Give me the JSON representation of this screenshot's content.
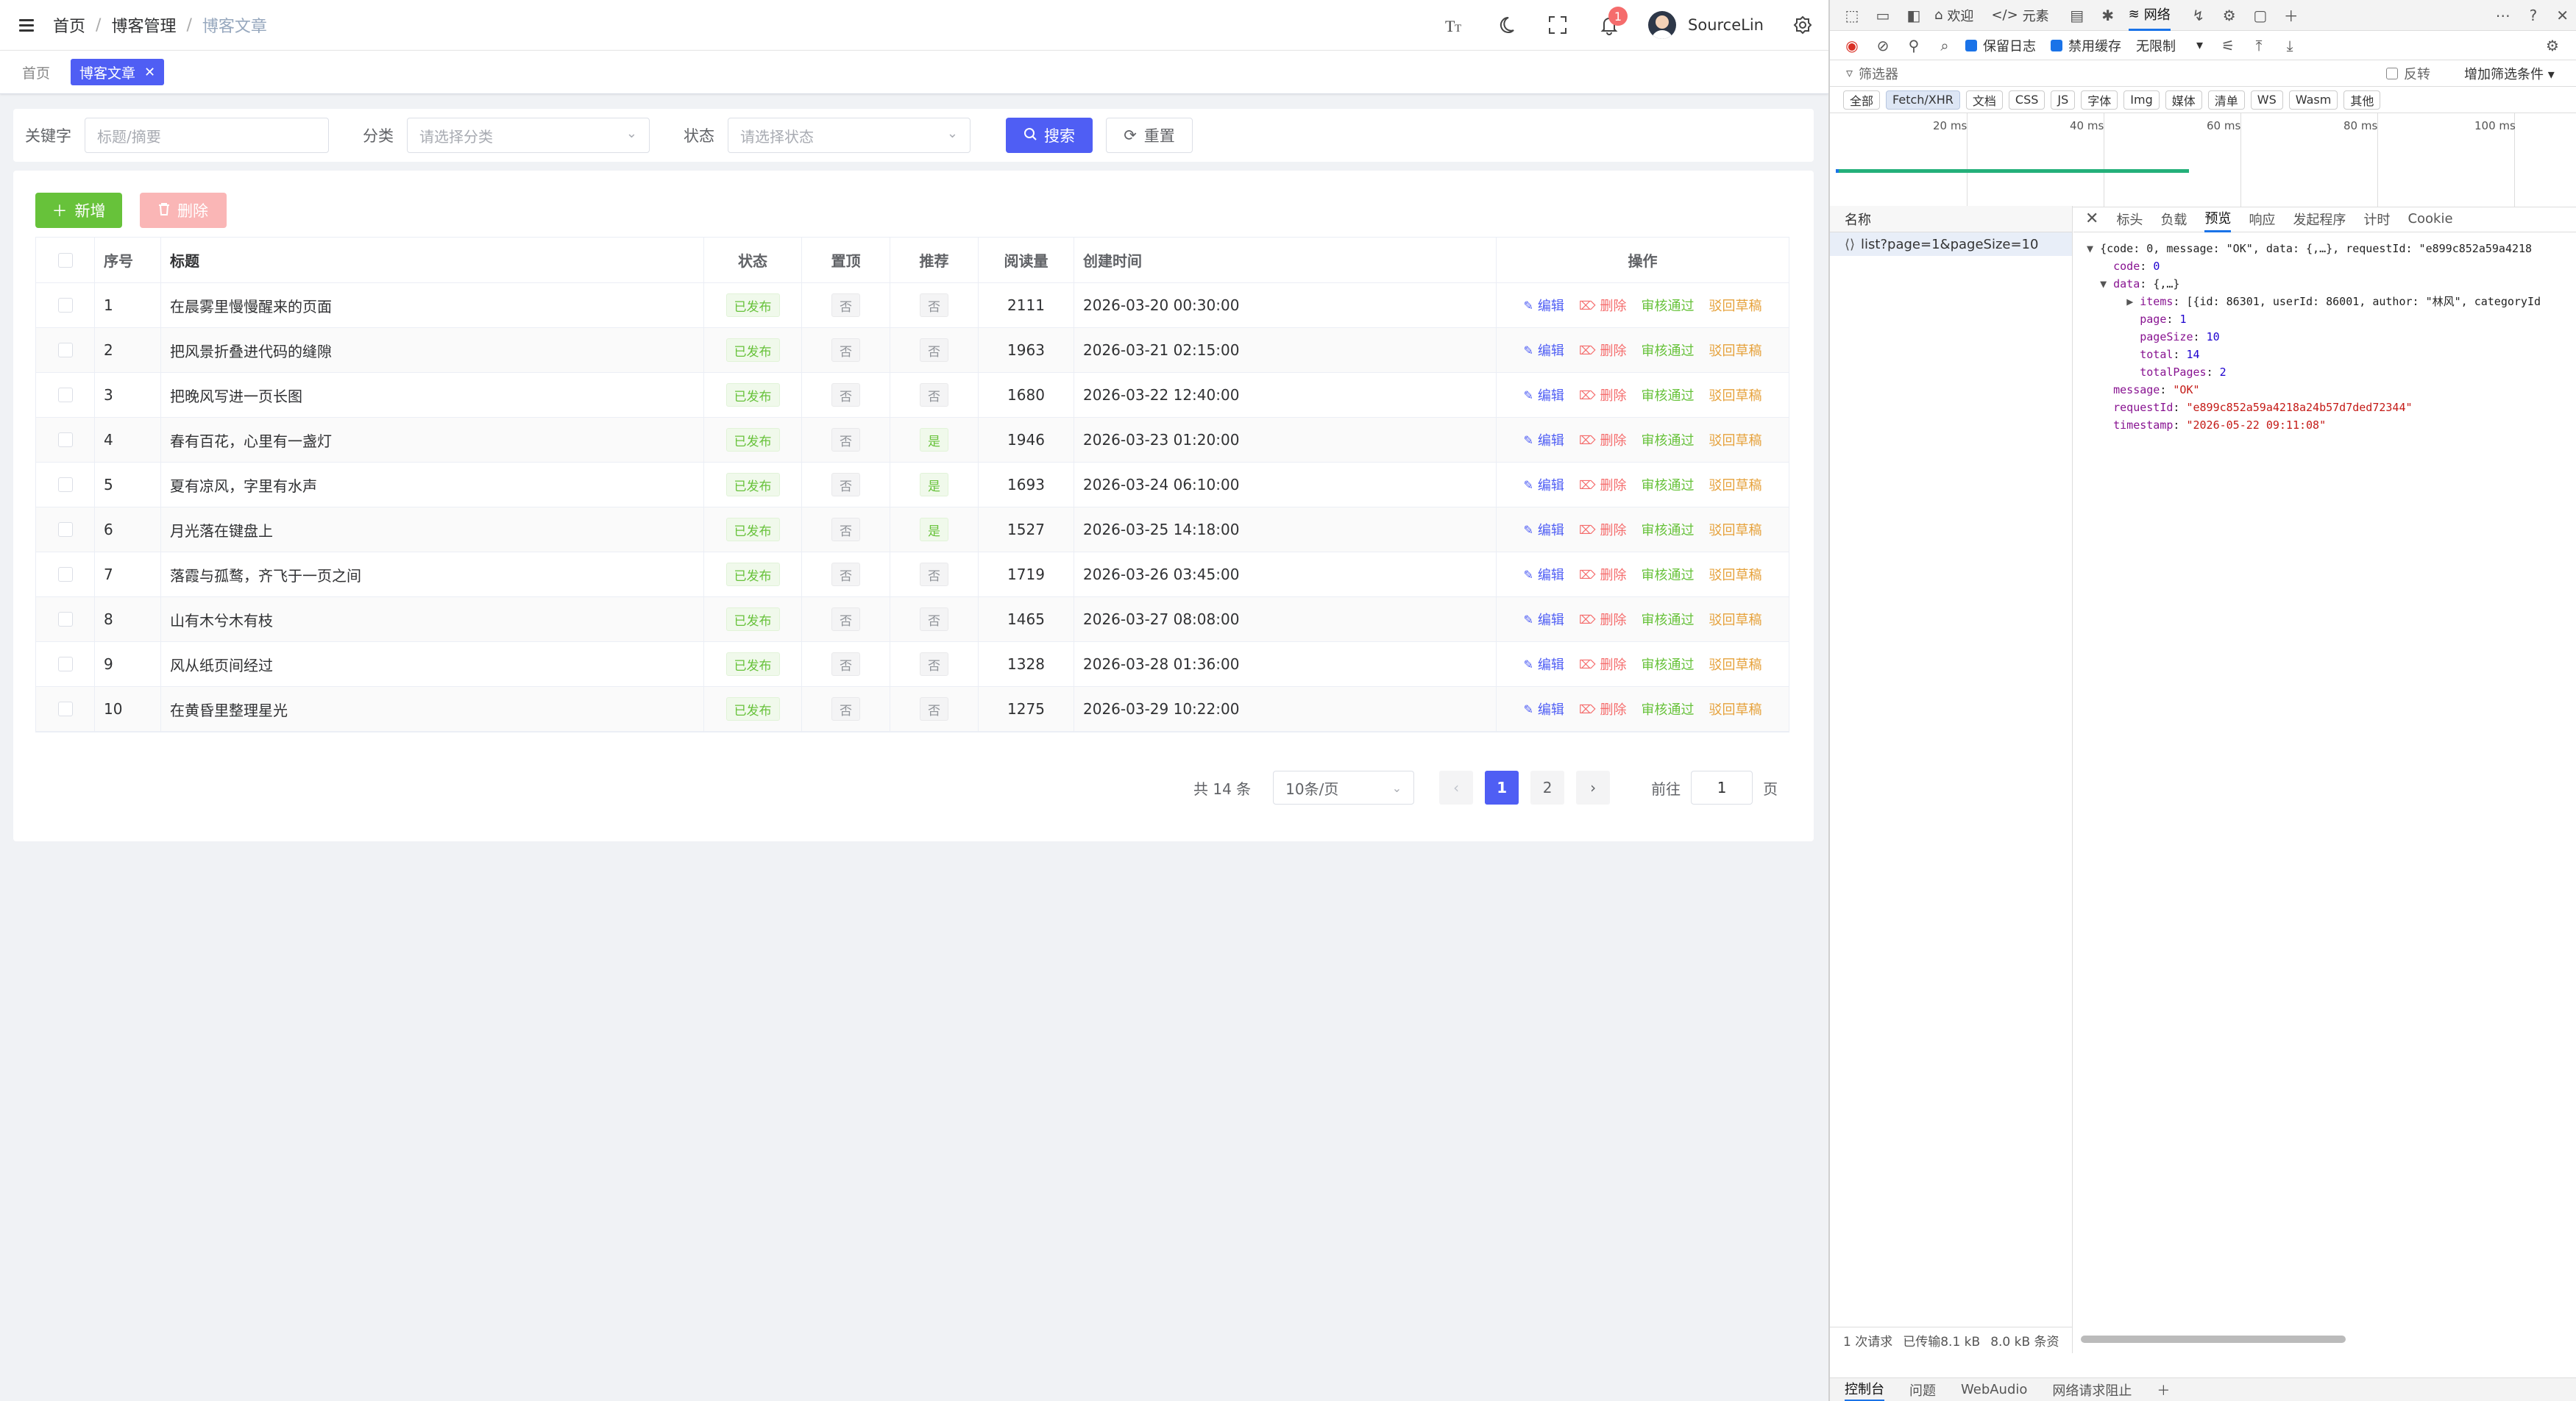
{
  "navbar": {
    "breadcrumb": [
      "首页",
      "博客管理",
      "博客文章"
    ],
    "notification_count": "1",
    "user_name": "SourceLin"
  },
  "tags": {
    "home": "首页",
    "active": "博客文章"
  },
  "search": {
    "keyword_label": "关键字",
    "keyword_placeholder": "标题/摘要",
    "category_label": "分类",
    "category_placeholder": "请选择分类",
    "status_label": "状态",
    "status_placeholder": "请选择状态",
    "search_button": "搜索",
    "reset_button": "重置"
  },
  "toolbar": {
    "add_button": "新增",
    "delete_button": "删除"
  },
  "table": {
    "columns": [
      "序号",
      "标题",
      "状态",
      "置顶",
      "推荐",
      "阅读量",
      "创建时间",
      "操作"
    ],
    "actions": [
      "编辑",
      "删除",
      "审核通过",
      "驳回草稿"
    ],
    "rows": [
      {
        "no": "1",
        "title": "在晨雾里慢慢醒来的页面",
        "status": "已发布",
        "top": "否",
        "recommend": "否",
        "views": "2111",
        "created": "2026-03-20 00:30:00"
      },
      {
        "no": "2",
        "title": "把风景折叠进代码的缝隙",
        "status": "已发布",
        "top": "否",
        "recommend": "否",
        "views": "1963",
        "created": "2026-03-21 02:15:00"
      },
      {
        "no": "3",
        "title": "把晚风写进一页长图",
        "status": "已发布",
        "top": "否",
        "recommend": "否",
        "views": "1680",
        "created": "2026-03-22 12:40:00"
      },
      {
        "no": "4",
        "title": "春有百花，心里有一盏灯",
        "status": "已发布",
        "top": "否",
        "recommend": "是",
        "views": "1946",
        "created": "2026-03-23 01:20:00"
      },
      {
        "no": "5",
        "title": "夏有凉风，字里有水声",
        "status": "已发布",
        "top": "否",
        "recommend": "是",
        "views": "1693",
        "created": "2026-03-24 06:10:00"
      },
      {
        "no": "6",
        "title": "月光落在键盘上",
        "status": "已发布",
        "top": "否",
        "recommend": "是",
        "views": "1527",
        "created": "2026-03-25 14:18:00"
      },
      {
        "no": "7",
        "title": "落霞与孤鹜，齐飞于一页之间",
        "status": "已发布",
        "top": "否",
        "recommend": "否",
        "views": "1719",
        "created": "2026-03-26 03:45:00"
      },
      {
        "no": "8",
        "title": "山有木兮木有枝",
        "status": "已发布",
        "top": "否",
        "recommend": "否",
        "views": "1465",
        "created": "2026-03-27 08:08:00"
      },
      {
        "no": "9",
        "title": "风从纸页间经过",
        "status": "已发布",
        "top": "否",
        "recommend": "否",
        "views": "1328",
        "created": "2026-03-28 01:36:00"
      },
      {
        "no": "10",
        "title": "在黄昏里整理星光",
        "status": "已发布",
        "top": "否",
        "recommend": "否",
        "views": "1275",
        "created": "2026-03-29 10:22:00"
      }
    ]
  },
  "pagination": {
    "total": "共 14 条",
    "page_size": "10条/页",
    "pages": [
      "1",
      "2"
    ],
    "current": "1",
    "goto_label": "前往",
    "goto_value": "1",
    "page_suffix": "页"
  },
  "devtools": {
    "tabs": [
      "欢迎",
      "元素",
      "网络"
    ],
    "preserve_log": "保留日志",
    "disable_cache": "禁用缓存",
    "throttle": "无限制",
    "filter_placeholder": "筛选器",
    "invert": "反转",
    "more_filters": "增加筛选条件",
    "types": [
      "全部",
      "Fetch/XHR",
      "文档",
      "CSS",
      "JS",
      "字体",
      "Img",
      "媒体",
      "清单",
      "WS",
      "Wasm",
      "其他"
    ],
    "timeline_labels": [
      "20 ms",
      "40 ms",
      "60 ms",
      "80 ms",
      "100 ms"
    ],
    "name_header": "名称",
    "request_name": "list?page=1&pageSize=10",
    "detail_tabs": [
      "标头",
      "负载",
      "预览",
      "响应",
      "发起程序",
      "计时",
      "Cookie"
    ],
    "json_preview": {
      "summary": "{code: 0, message: \"OK\", data: {,…}, requestId: \"e899c852a59a4218",
      "code": "0",
      "data_collapsed": "{,…}",
      "items_preview": "[{id: 86301, userId: 86001, author: \"林风\", categoryId",
      "page": "1",
      "pageSize": "10",
      "total": "14",
      "totalPages": "2",
      "message": "\"OK\"",
      "requestId": "\"e899c852a59a4218a24b57d7ded72344\"",
      "timestamp": "\"2026-05-22 09:11:08\""
    },
    "footer": [
      "1 次请求",
      "已传输8.1 kB",
      "8.0 kB 条资"
    ],
    "bottom_tabs": [
      "控制台",
      "问题",
      "WebAudio",
      "网络请求阻止"
    ]
  },
  "colors": {
    "primary": "#4f5ef4",
    "success": "#67c23a",
    "danger": "#f56c6c",
    "warning": "#e6a23c"
  }
}
